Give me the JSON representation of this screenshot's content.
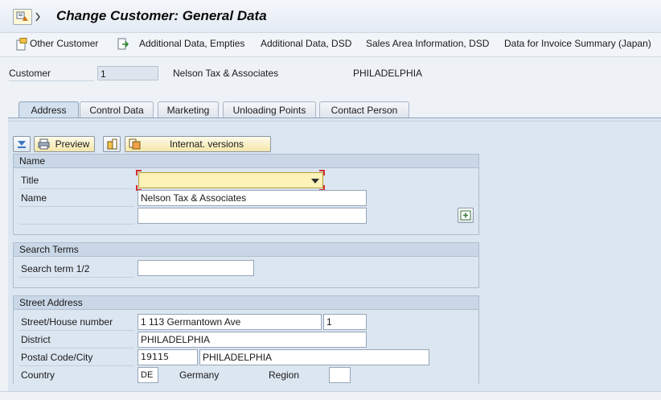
{
  "window": {
    "title": "Change Customer: General Data"
  },
  "toolbar": {
    "other_customer": "Other Customer",
    "additional_data_empties": "Additional Data, Empties",
    "additional_data_dsd": "Additional Data, DSD",
    "sales_area_info": "Sales Area Information, DSD",
    "invoice_summary": "Data for Invoice Summary (Japan)"
  },
  "header": {
    "customer_label": "Customer",
    "customer_number": "1",
    "customer_name": "Nelson Tax & Associates",
    "customer_city": "PHILADELPHIA"
  },
  "tabs": [
    {
      "label": "Address",
      "active": true
    },
    {
      "label": "Control Data",
      "active": false
    },
    {
      "label": "Marketing",
      "active": false
    },
    {
      "label": "Unloading Points",
      "active": false
    },
    {
      "label": "Contact Person",
      "active": false
    }
  ],
  "actions": {
    "preview": "Preview",
    "internat_versions": "Internat. versions"
  },
  "name_group": {
    "header": "Name",
    "title_label": "Title",
    "title_value": "",
    "name_label": "Name",
    "name_value": "Nelson Tax & Associates",
    "name2_value": ""
  },
  "search_group": {
    "header": "Search Terms",
    "search_label": "Search term 1/2",
    "search_value": ""
  },
  "street_group": {
    "header": "Street Address",
    "street_label": "Street/House number",
    "street_value": "1 113 Germantown Ave",
    "house_value": "1",
    "district_label": "District",
    "district_value": "PHILADELPHIA",
    "postal_label": "Postal Code/City",
    "postal_value": "19115",
    "city_value": "PHILADELPHIA",
    "country_label": "Country",
    "country_value": "DE",
    "country_name": "Germany",
    "region_label": "Region",
    "region_value": ""
  },
  "colors": {
    "required_field": "#fdf2b8",
    "panel_bg": "#dbe6f1",
    "button_accent": "#f4e6a8"
  }
}
